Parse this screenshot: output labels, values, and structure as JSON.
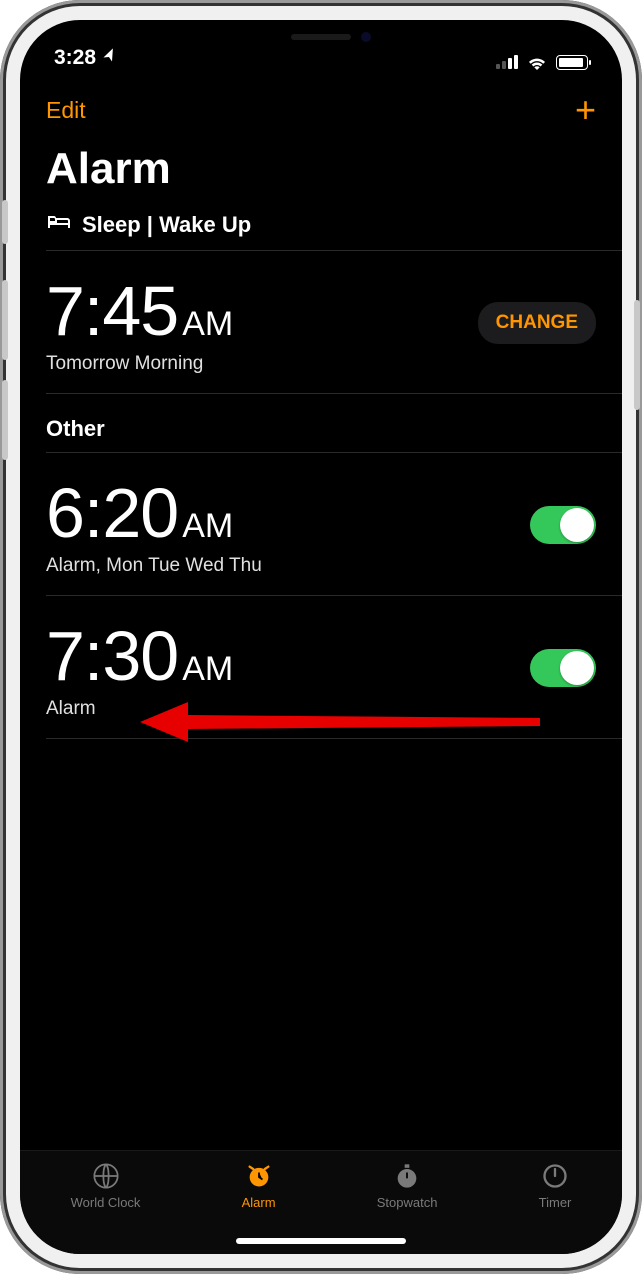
{
  "status": {
    "time": "3:28",
    "location_arrow": "➤"
  },
  "nav": {
    "edit": "Edit",
    "add": "+"
  },
  "title": "Alarm",
  "sleep_section": {
    "label": "Sleep | Wake Up",
    "time": "7:45",
    "ampm": "AM",
    "subtitle": "Tomorrow Morning",
    "change": "CHANGE"
  },
  "other_section": {
    "label": "Other",
    "alarms": [
      {
        "time": "6:20",
        "ampm": "AM",
        "subtitle": "Alarm, Mon Tue Wed Thu",
        "enabled": true
      },
      {
        "time": "7:30",
        "ampm": "AM",
        "subtitle": "Alarm",
        "enabled": true
      }
    ]
  },
  "tabs": {
    "world_clock": "World Clock",
    "alarm": "Alarm",
    "stopwatch": "Stopwatch",
    "timer": "Timer"
  },
  "colors": {
    "accent": "#ff9500",
    "toggle_on": "#34c759"
  }
}
